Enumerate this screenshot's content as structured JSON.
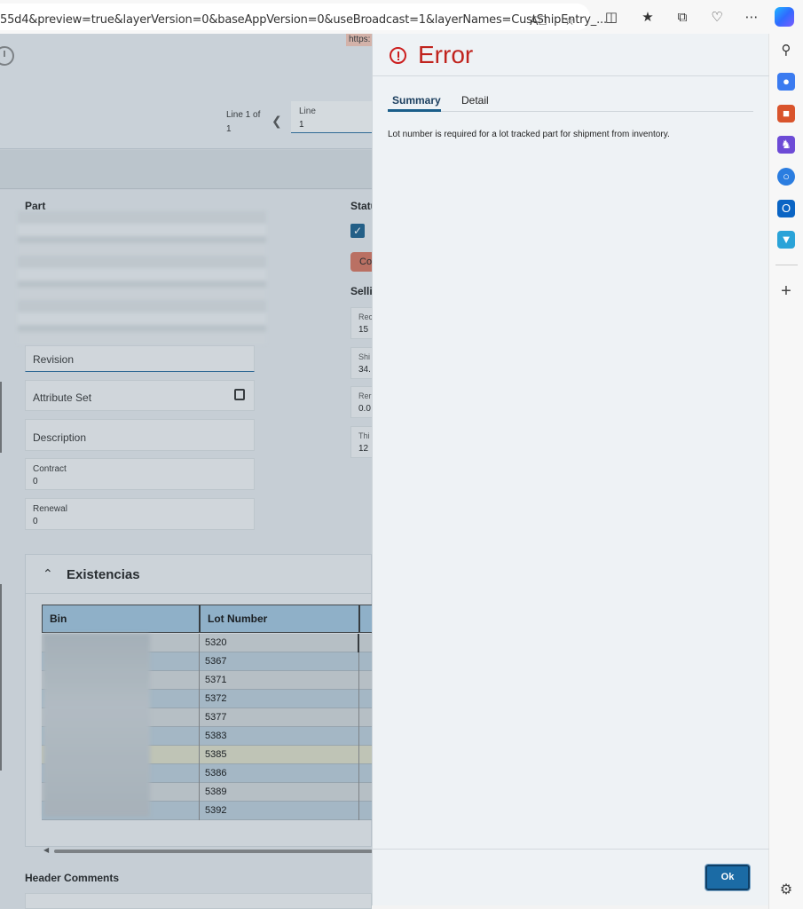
{
  "browser": {
    "url": "55d4&preview=true&layerVersion=0&baseAppVersion=0&useBroadcast=1&layerNames=CustShipEntry_...",
    "icons": [
      "read-aloud-icon",
      "favorite-star-icon",
      "split-screen-icon",
      "favorites-icon",
      "collections-icon",
      "browser-essentials-icon",
      "more-icon",
      "copilot-icon"
    ]
  },
  "sidebar": {
    "icons": [
      "search-icon",
      "shopping-icon",
      "tools-icon",
      "games-icon",
      "microsoft-365-icon",
      "outlook-icon",
      "drop-icon",
      "add-icon",
      "settings-icon"
    ]
  },
  "app": {
    "https_tag": "https:",
    "line_of": "Line 1 of",
    "line_of_count": "1",
    "line_field": {
      "label": "Line",
      "value": "1"
    },
    "part_label": "Part",
    "status_label": "Statu",
    "red_pill_text": "Co",
    "selling_label": "Selli",
    "revision_label": "Revision",
    "attribute_set_label": "Attribute Set",
    "description_label": "Description",
    "contract": {
      "label": "Contract",
      "value": "0"
    },
    "renewal": {
      "label": "Renewal",
      "value": "0"
    },
    "mini_fields": [
      {
        "label": "Rec",
        "value": "15"
      },
      {
        "label": "Shi",
        "value": "34."
      },
      {
        "label": "Rer",
        "value": "0.0"
      },
      {
        "label": "Thi",
        "value": "12"
      }
    ],
    "stock": {
      "title": "Existencias",
      "columns": [
        "Bin",
        "Lot Number"
      ],
      "lots": [
        "5320",
        "5367",
        "5371",
        "5372",
        "5377",
        "5383",
        "5385",
        "5386",
        "5389",
        "5392"
      ]
    },
    "header_comments": "Header Comments"
  },
  "error": {
    "title": "Error",
    "tabs": [
      "Summary",
      "Detail"
    ],
    "message": "Lot number is required for a lot tracked part for shipment from inventory.",
    "ok_label": "Ok",
    "accent": "#c0231d"
  }
}
